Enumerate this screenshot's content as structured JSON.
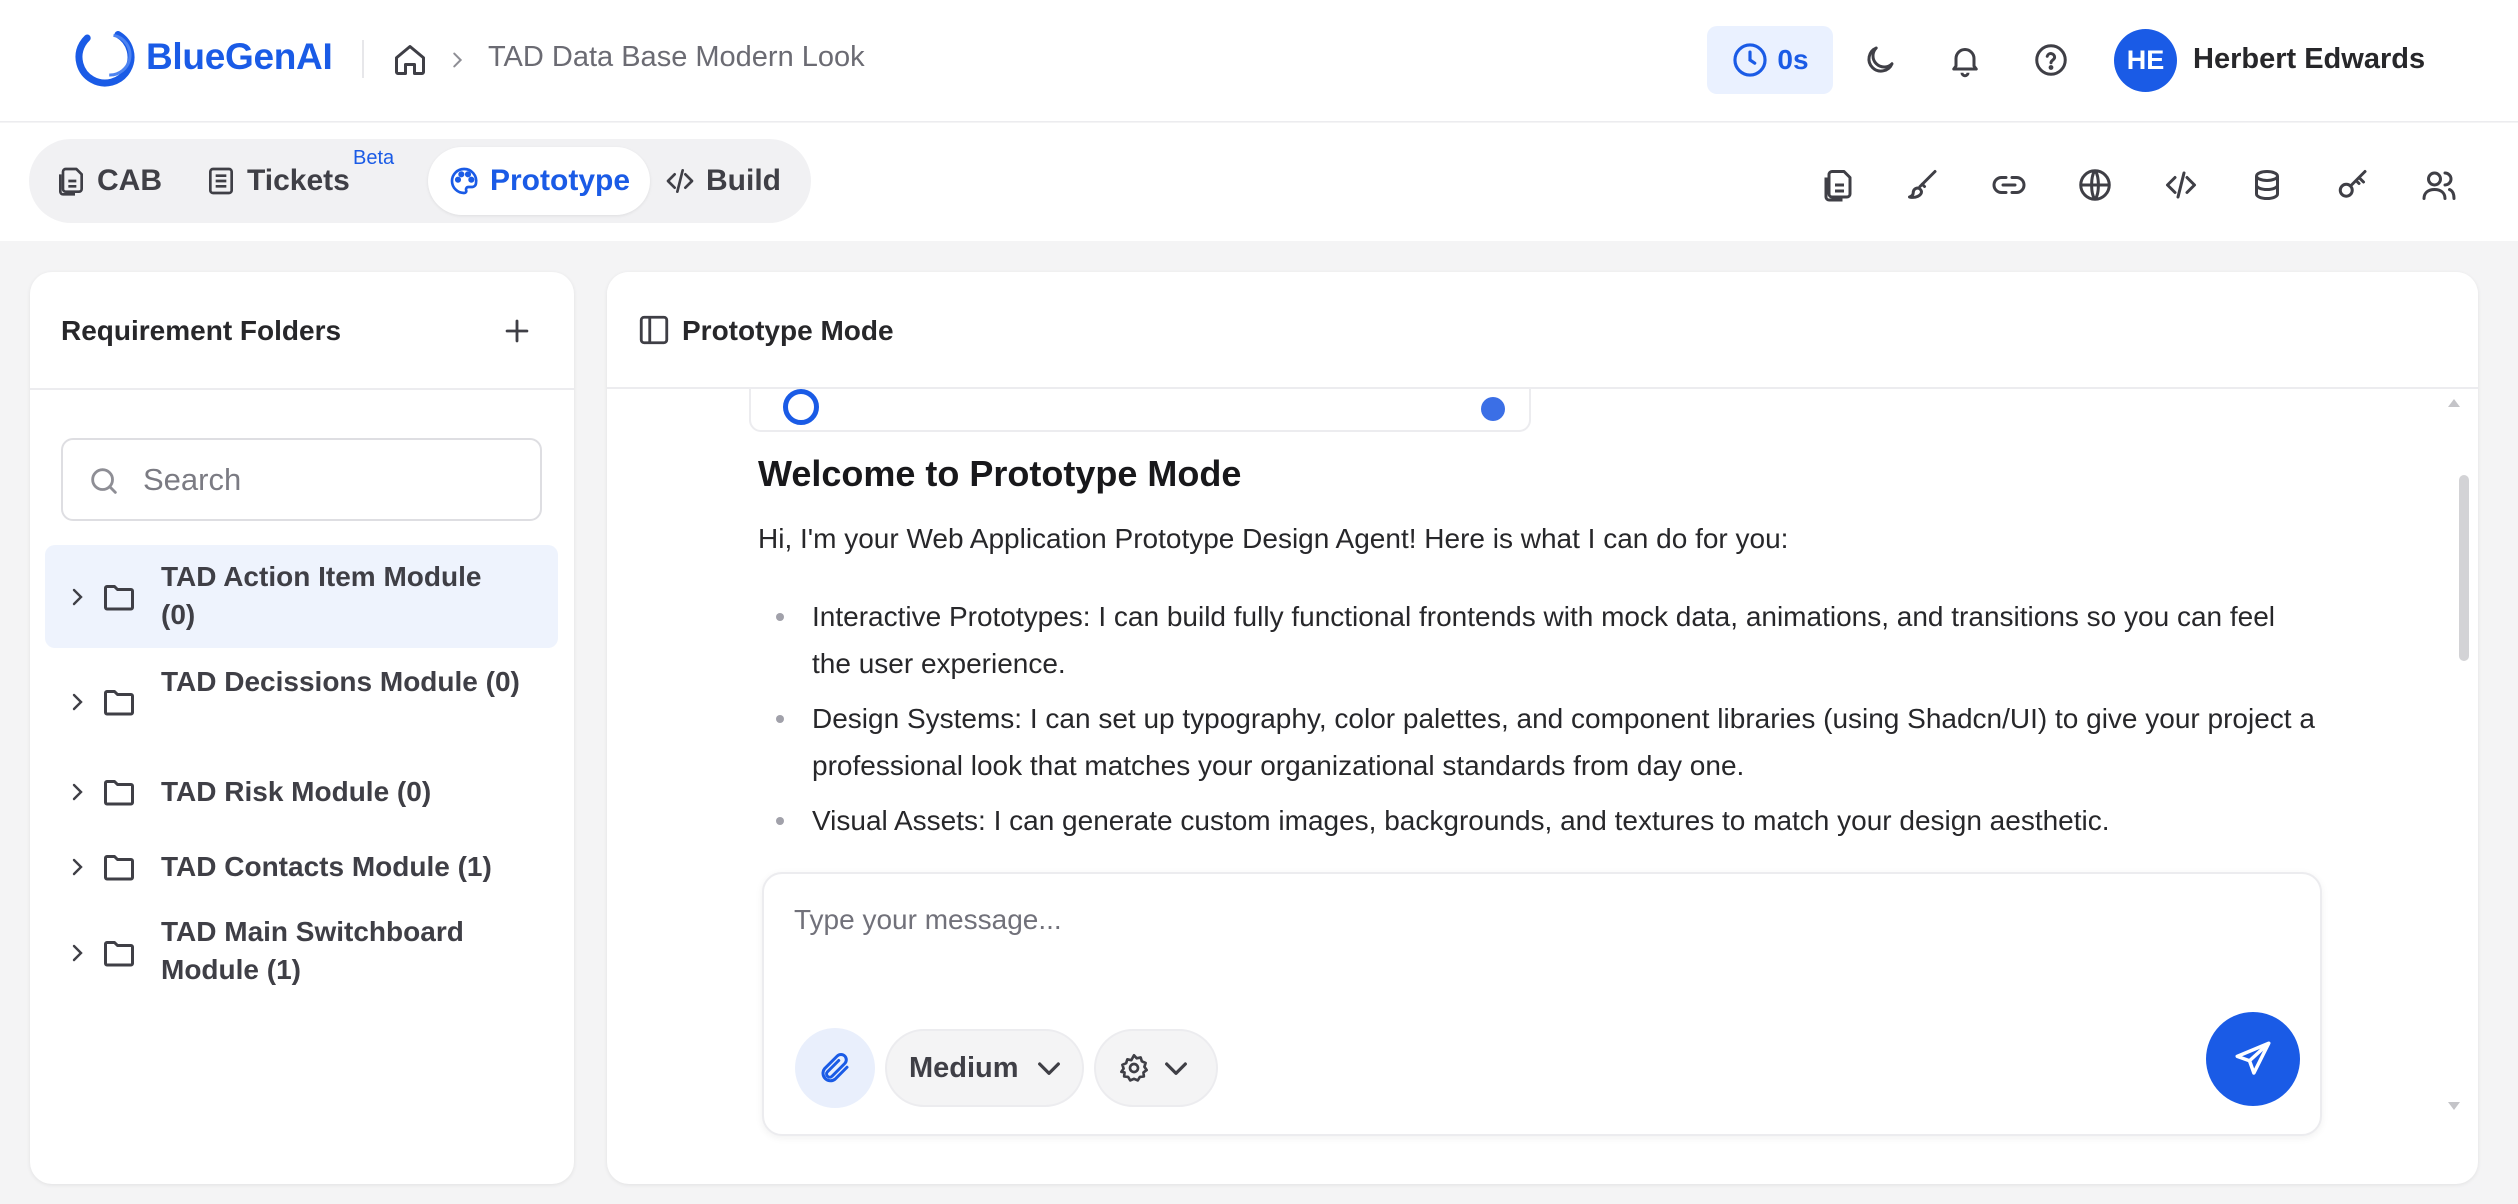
{
  "app": {
    "name": "BlueGenAI",
    "brand_color": "#1a5be6"
  },
  "header": {
    "breadcrumb_title": "TAD Data Base Modern Look",
    "timer": "0s",
    "user": {
      "initials": "HE",
      "name": "Herbert Edwards"
    },
    "icons": [
      "home-icon",
      "clock-icon",
      "moon-icon",
      "bell-icon",
      "help-icon"
    ]
  },
  "tabs": [
    {
      "label": "CAB",
      "icon": "files-icon",
      "active": false
    },
    {
      "label": "Tickets",
      "icon": "list-icon",
      "badge": "Beta",
      "active": false
    },
    {
      "label": "Prototype",
      "icon": "palette-icon",
      "active": true
    },
    {
      "label": "Build",
      "icon": "code-icon",
      "active": false
    }
  ],
  "toolbar_icons": [
    "document-icon",
    "brush-icon",
    "link-icon",
    "globe-icon",
    "code-icon",
    "database-icon",
    "key-icon",
    "users-icon"
  ],
  "sidebar": {
    "title": "Requirement Folders",
    "search_placeholder": "Search",
    "folders": [
      {
        "label": "TAD Action Item Module (0)",
        "selected": true
      },
      {
        "label": "TAD Decissions Module (0)",
        "selected": false
      },
      {
        "label": "TAD Risk Module (0)",
        "selected": false
      },
      {
        "label": "TAD Contacts Module (1)",
        "selected": false
      },
      {
        "label": "TAD Main Switchboard Module (1)",
        "selected": false
      }
    ]
  },
  "main": {
    "title": "Prototype Mode",
    "welcome_title": "Welcome to Prototype Mode",
    "intro": "Hi, I'm your Web Application Prototype Design Agent! Here is what I can do for you:",
    "features": [
      "Interactive Prototypes: I can build fully functional frontends with mock data, animations, and transitions so you can feel the user experience.",
      "Design Systems: I can set up typography, color palettes, and component libraries (using Shadcn/UI) to give your project a professional look that matches your organizational standards from day one.",
      "Visual Assets: I can generate custom images, backgrounds, and textures to match your design aesthetic."
    ]
  },
  "composer": {
    "placeholder": "Type your message...",
    "model": "Medium"
  }
}
